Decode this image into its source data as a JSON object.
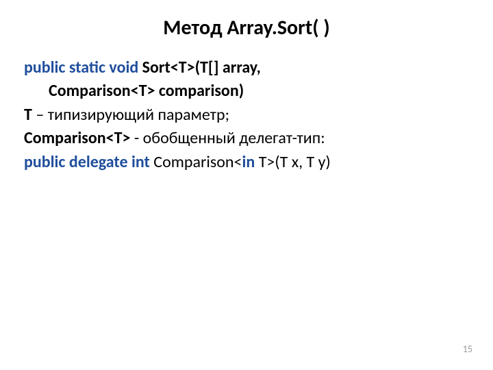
{
  "title": "Метод Array.Sort( )",
  "lines": {
    "l1_kw": "public static void",
    "l1_rest": " Sort<T>(T[] array,",
    "l2": "Comparison<T> comparison)",
    "l3_bold": "T",
    "l3_rest": " – типизирующий параметр;",
    "l4_bold": "Comparison<T>",
    "l4_rest": " - обобщенный делегат-тип:",
    "l5_kw1": "public delegate int",
    "l5_mid": " Comparison<",
    "l5_kw2": "in",
    "l5_end": " T>(T x, T y)"
  },
  "page_number": "15"
}
